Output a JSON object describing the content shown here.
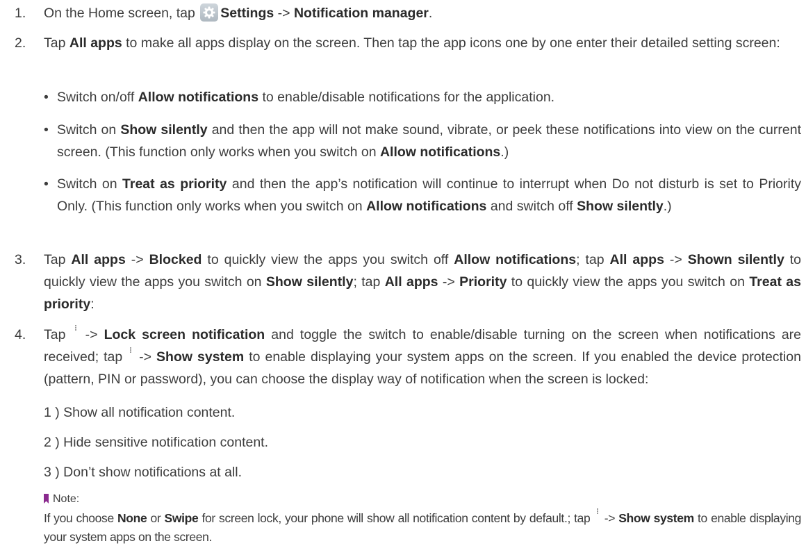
{
  "steps": [
    {
      "num": "1.",
      "a": "On the Home screen, tap",
      "b1": "Settings",
      "c": " -> ",
      "b2": "Notification manager",
      "d": "."
    },
    {
      "num": "2.",
      "a": "Tap ",
      "b1": "All apps",
      "c": " to make all apps display on the screen. Then tap the app icons one by one enter their detailed setting screen:",
      "bullets": [
        {
          "dot": "•",
          "a": "Switch on/off ",
          "b1": "Allow notifications",
          "c": " to enable/disable notifications for the application."
        },
        {
          "dot": "•",
          "a": "Switch on ",
          "b1": "Show silently",
          "c": " and then the app will not make sound, vibrate, or peek these notifications into view on the current screen. (This function only works when you switch on ",
          "b2": "Allow notifications",
          "d": ".)"
        },
        {
          "dot": "•",
          "a": "Switch on ",
          "b1": "Treat as priority",
          "c": " and then the app’s notification will continue to interrupt when Do not disturb is set to Priority Only. (This function only works when you switch on ",
          "b2": "Allow notifications",
          "d": " and switch off ",
          "b3": "Show silently",
          "e": ".)"
        }
      ]
    },
    {
      "num": "3.",
      "a": "Tap ",
      "b1": "All apps",
      "c": " -> ",
      "b2": "Blocked",
      "d": " to quickly view the apps you switch off ",
      "b3": "Allow notifications",
      "e": "; tap ",
      "b4": "All apps",
      "f": " -> ",
      "b5": "Shown silently",
      "g": " to quickly view the apps you switch on ",
      "b6": "Show silently",
      "h": "; tap ",
      "b7": "All apps",
      "i": " -> ",
      "b8": "Priority",
      "j": " to quickly view the apps you switch on ",
      "b9": "Treat as priority",
      "k": ":"
    },
    {
      "num": "4.",
      "a": "Tap ",
      "c": " -> ",
      "b1": "Lock screen notification",
      "d": " and toggle the switch to enable/disable turning on the screen when notifications are received; tap ",
      "e": " -> ",
      "b2": "Show system",
      "f": " to enable displaying your system apps on the screen. If you enabled the device protection (pattern, PIN or password), you can choose the display way of notification when the screen is locked:",
      "options": [
        "1 )  Show all notification content.",
        "2 )  Hide sensitive notification content.",
        "3 )  Don’t show notifications at all."
      ],
      "note_label": "Note:",
      "note": {
        "a": "If you choose ",
        "b1": "None",
        "c": " or ",
        "b2": "Swipe",
        "d": " for screen lock, your phone will show all notification content by default.; tap ",
        "e": " -> ",
        "b3": "Show system",
        "f": " to enable displaying your system apps on the screen."
      }
    }
  ],
  "icons": {
    "settings": "gear-icon",
    "menu": "more-vert-icon"
  }
}
